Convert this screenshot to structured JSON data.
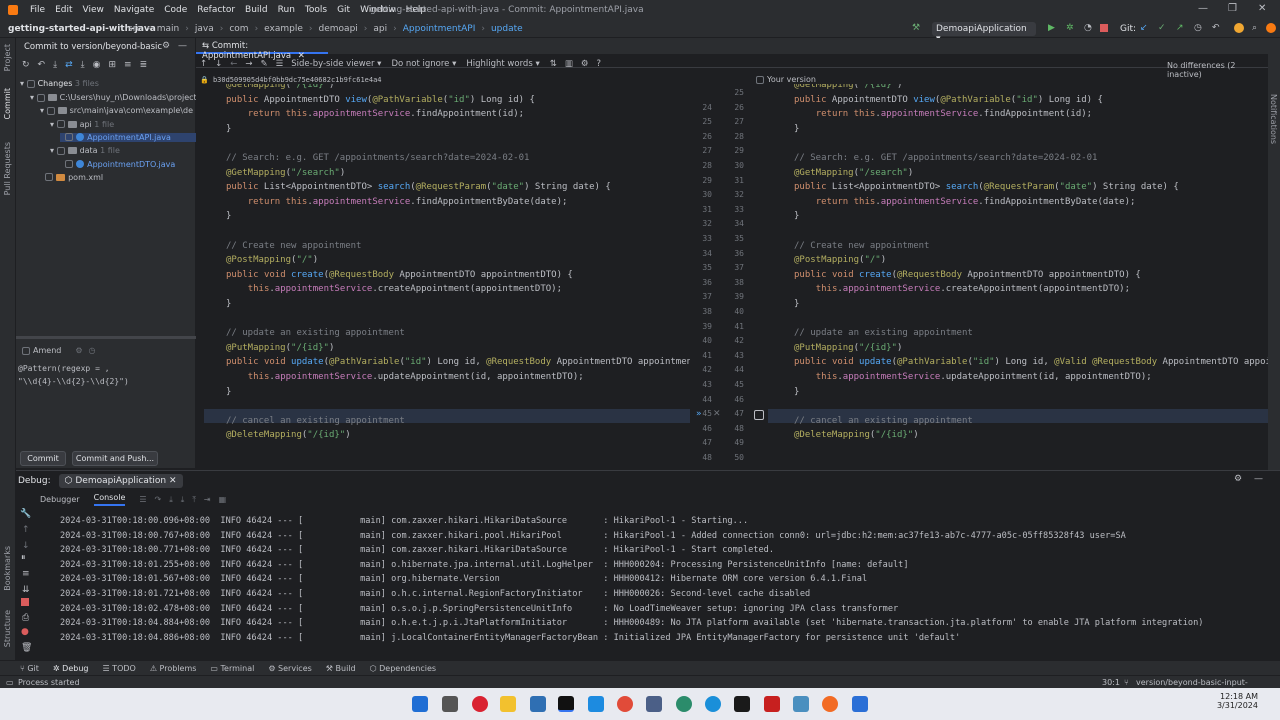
{
  "menubar": {
    "items": [
      "File",
      "Edit",
      "View",
      "Navigate",
      "Code",
      "Refactor",
      "Build",
      "Run",
      "Tools",
      "Git",
      "Window",
      "Help"
    ],
    "window_title": "getting-started-api-with-java - Commit: AppointmentAPI.java"
  },
  "navbar": {
    "project": "getting-started-api-with-java",
    "crumbs": [
      "src",
      "main",
      "java",
      "com",
      "example",
      "demoapi",
      "api",
      "AppointmentAPI",
      "update"
    ],
    "run_config": "DemoapiApplication",
    "git_label": "Git:"
  },
  "commit_panel": {
    "header": "Commit to version/beyond-basic",
    "changes_label": "Changes",
    "changes_count": "3 files",
    "tree": [
      {
        "label": "C:\\Users\\huy_n\\Downloads\\project",
        "indent": 0
      },
      {
        "label": "src\\main\\java\\com\\example\\de",
        "indent": 1
      },
      {
        "label": "api",
        "count": "1 file",
        "indent": 2
      },
      {
        "label": "AppointmentAPI.java",
        "indent": 3,
        "selected": true
      },
      {
        "label": "data",
        "count": "1 file",
        "indent": 2
      },
      {
        "label": "AppointmentDTO.java",
        "indent": 3
      },
      {
        "label": "pom.xml",
        "indent": 1
      }
    ],
    "amend_label": "Amend",
    "message_lines": [
      "@Pattern(regexp = ,",
      "\"\\\\d{4}-\\\\d{2}-\\\\d{2}\")"
    ],
    "commit_button": "Commit",
    "commit_push_button": "Commit and Push..."
  },
  "diff_toolbar": {
    "viewer": "Side-by-side viewer",
    "ignore": "Do not ignore",
    "highlight": "Highlight words",
    "hash": "b30d509905d4bf0bb9dc75e40682c1b9fc61e4a4",
    "your_version": "Your version",
    "status": "No differences (2 inactive)"
  },
  "diff": {
    "left_lines": [
      "@GetMapping(\"/{id}\")",
      "public AppointmentDTO view(@PathVariable(\"id\") Long id) {",
      "    return this.appointmentService.findAppointment(id);",
      "}",
      "",
      "// Search: e.g. GET /appointments/search?date=2024-02-01",
      "@GetMapping(\"/search\")",
      "public List<AppointmentDTO> search(@RequestParam(\"date\") String date) {",
      "    return this.appointmentService.findAppointmentByDate(date);",
      "}",
      "",
      "// Create new appointment",
      "@PostMapping(\"/\")",
      "public void create(@RequestBody AppointmentDTO appointmentDTO) {",
      "    this.appointmentService.createAppointment(appointmentDTO);",
      "}",
      "",
      "// update an existing appointment",
      "@PutMapping(\"/{id}\")",
      "public void update(@PathVariable(\"id\") Long id, @RequestBody AppointmentDTO appointmen",
      "    this.appointmentService.updateAppointment(id, appointmentDTO);",
      "}",
      "",
      "// cancel an existing appointment",
      "@DeleteMapping(\"/{id}\")"
    ],
    "right_lines": [
      "@GetMapping(\"/{id}\")",
      "public AppointmentDTO view(@PathVariable(\"id\") Long id) {",
      "    return this.appointmentService.findAppointment(id);",
      "}",
      "",
      "// Search: e.g. GET /appointments/search?date=2024-02-01",
      "@GetMapping(\"/search\")",
      "public List<AppointmentDTO> search(@RequestParam(\"date\") String date) {",
      "    return this.appointmentService.findAppointmentByDate(date);",
      "}",
      "",
      "// Create new appointment",
      "@PostMapping(\"/\")",
      "public void create(@RequestBody AppointmentDTO appointmentDTO) {",
      "    this.appointmentService.createAppointment(appointmentDTO);",
      "}",
      "",
      "// update an existing appointment",
      "@PutMapping(\"/{id}\")",
      "public void update(@PathVariable(\"id\") Long id, @Valid @RequestBody AppointmentDTO appoi",
      "    this.appointmentService.updateAppointment(id, appointmentDTO);",
      "}",
      "",
      "// cancel an existing appointment",
      "@DeleteMapping(\"/{id}\")"
    ],
    "left_numbers": [
      "",
      "24",
      "25",
      "26",
      "27",
      "28",
      "29",
      "30",
      "31",
      "32",
      "33",
      "34",
      "35",
      "36",
      "37",
      "38",
      "39",
      "40",
      "41",
      "42",
      "43",
      "44",
      "45",
      "46",
      "47",
      "48"
    ],
    "right_numbers": [
      "25",
      "26",
      "27",
      "28",
      "29",
      "30",
      "31",
      "32",
      "33",
      "34",
      "35",
      "36",
      "37",
      "38",
      "39",
      "40",
      "41",
      "42",
      "43",
      "44",
      "45",
      "46",
      "47",
      "48",
      "49",
      "50"
    ]
  },
  "debug": {
    "label": "Debug:",
    "tab": "DemoapiApplication",
    "subtabs": [
      "Debugger",
      "Console"
    ],
    "logs": [
      "2024-03-31T00:18:00.096+08:00  INFO 46424 --- [           main] com.zaxxer.hikari.HikariDataSource       : HikariPool-1 - Starting...",
      "2024-03-31T00:18:00.767+08:00  INFO 46424 --- [           main] com.zaxxer.hikari.pool.HikariPool        : HikariPool-1 - Added connection conn0: url=jdbc:h2:mem:ac37fe13-ab7c-4777-a05c-05ff85328f43 user=SA",
      "2024-03-31T00:18:00.771+08:00  INFO 46424 --- [           main] com.zaxxer.hikari.HikariDataSource       : HikariPool-1 - Start completed.",
      "2024-03-31T00:18:01.255+08:00  INFO 46424 --- [           main] o.hibernate.jpa.internal.util.LogHelper  : HHH000204: Processing PersistenceUnitInfo [name: default]",
      "2024-03-31T00:18:01.567+08:00  INFO 46424 --- [           main] org.hibernate.Version                    : HHH000412: Hibernate ORM core version 6.4.1.Final",
      "2024-03-31T00:18:01.721+08:00  INFO 46424 --- [           main] o.h.c.internal.RegionFactoryInitiator    : HHH000026: Second-level cache disabled",
      "2024-03-31T00:18:02.478+08:00  INFO 46424 --- [           main] o.s.o.j.p.SpringPersistenceUnitInfo      : No LoadTimeWeaver setup: ignoring JPA class transformer",
      "2024-03-31T00:18:04.884+08:00  INFO 46424 --- [           main] o.h.e.t.j.p.i.JtaPlatformInitiator       : HHH000489: No JTA platform available (set 'hibernate.transaction.jta.platform' to enable JTA platform integration)",
      "2024-03-31T00:18:04.886+08:00  INFO 46424 --- [           main] j.LocalContainerEntityManagerFactoryBean : Initialized JPA EntityManagerFactory for persistence unit 'default'"
    ]
  },
  "toolbar": {
    "items": [
      "Git",
      "Debug",
      "TODO",
      "Problems",
      "Terminal",
      "Services",
      "Build",
      "Dependencies"
    ]
  },
  "statusbar": {
    "left": "Process started",
    "position": "30:1",
    "branch": "version/beyond-basic-input-validation"
  },
  "taskbar": {
    "time": "12:18 AM",
    "date": "3/31/2024"
  },
  "left_strip": [
    "Project",
    "Commit",
    "Pull Requests",
    "Bookmarks",
    "Structure"
  ],
  "right_strip": [
    "Notifications"
  ]
}
